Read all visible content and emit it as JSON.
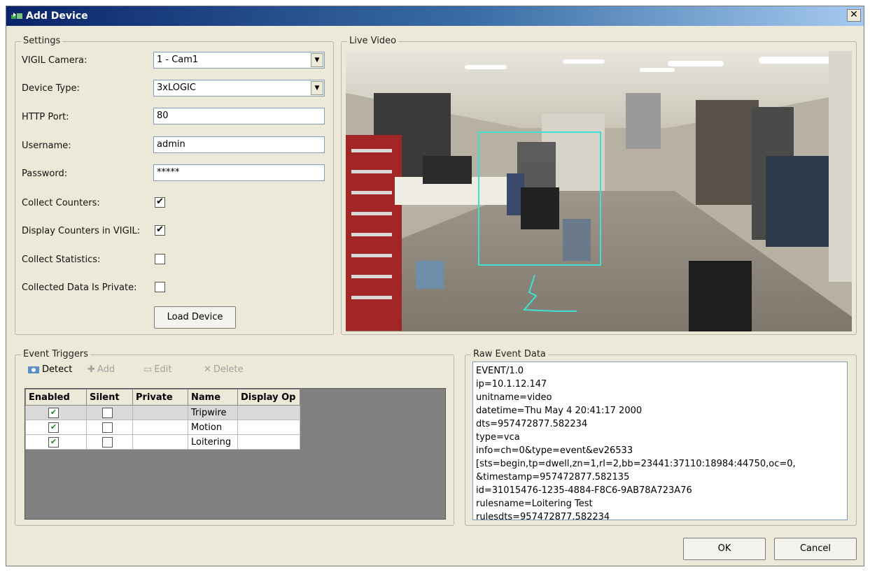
{
  "window": {
    "title": "Add Device"
  },
  "settings": {
    "legend": "Settings",
    "vigil_camera": {
      "label": "VIGIL Camera:",
      "value": "1 - Cam1"
    },
    "device_type": {
      "label": "Device Type:",
      "value": "3xLOGIC"
    },
    "http_port": {
      "label": "HTTP Port:",
      "value": "80"
    },
    "username": {
      "label": "Username:",
      "value": "admin"
    },
    "password": {
      "label": "Password:",
      "value": "*****"
    },
    "collect_counters": {
      "label": "Collect Counters:",
      "checked": true
    },
    "display_counters": {
      "label": "Display Counters in VIGIL:",
      "checked": true
    },
    "collect_statistics": {
      "label": "Collect Statistics:",
      "checked": false
    },
    "data_private": {
      "label": "Collected Data Is Private:",
      "checked": false
    },
    "load_button": "Load Device"
  },
  "live_video": {
    "legend": "Live Video"
  },
  "event_triggers": {
    "legend": "Event Triggers",
    "toolbar": {
      "detect": "Detect",
      "add": "Add",
      "edit": "Edit",
      "delete": "Delete"
    },
    "columns": [
      "Enabled",
      "Silent",
      "Private",
      "Name",
      "Display Op"
    ],
    "rows": [
      {
        "enabled": true,
        "silent": false,
        "name": "Tripwire"
      },
      {
        "enabled": true,
        "silent": false,
        "name": "Motion"
      },
      {
        "enabled": true,
        "silent": false,
        "name": "Loitering"
      }
    ]
  },
  "raw_event": {
    "legend": "Raw Event Data",
    "lines": [
      "EVENT/1.0",
      "ip=10.1.12.147",
      "unitname=video",
      "datetime=Thu May  4 20:41:17 2000",
      "dts=957472877.582234",
      "type=vca",
      "info=ch=0&type=event&ev26533",
      "[sts=begin,tp=dwell,zn=1,rl=2,bb=23441:37110:18984:44750,oc=0,",
      "&timestamp=957472877.582135",
      "id=31015476-1235-4884-F8C6-9AB78A723A76",
      "rulesname=Loitering Test",
      "rulesdts=957472877.582234"
    ]
  },
  "footer": {
    "ok": "OK",
    "cancel": "Cancel"
  },
  "colors": {
    "title_start": "#0a246a",
    "title_end": "#a6caf0",
    "overlay": "#40e0d0"
  }
}
